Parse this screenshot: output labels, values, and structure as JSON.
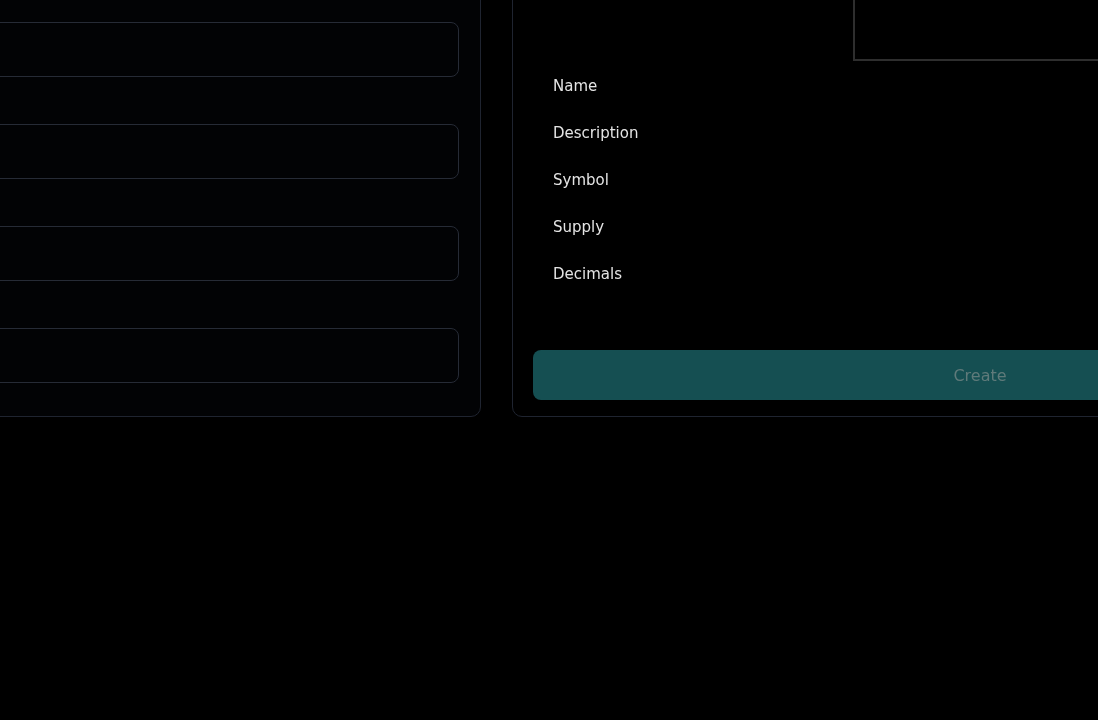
{
  "left_form": {
    "fields": [
      {
        "kind": "input"
      },
      {
        "kind": "input"
      },
      {
        "kind": "input"
      },
      {
        "kind": "input"
      }
    ]
  },
  "summary": {
    "labels": [
      "Name",
      "Description",
      "Symbol",
      "Supply",
      "Decimals"
    ],
    "button": {
      "label": "Create",
      "disabled": true
    }
  }
}
